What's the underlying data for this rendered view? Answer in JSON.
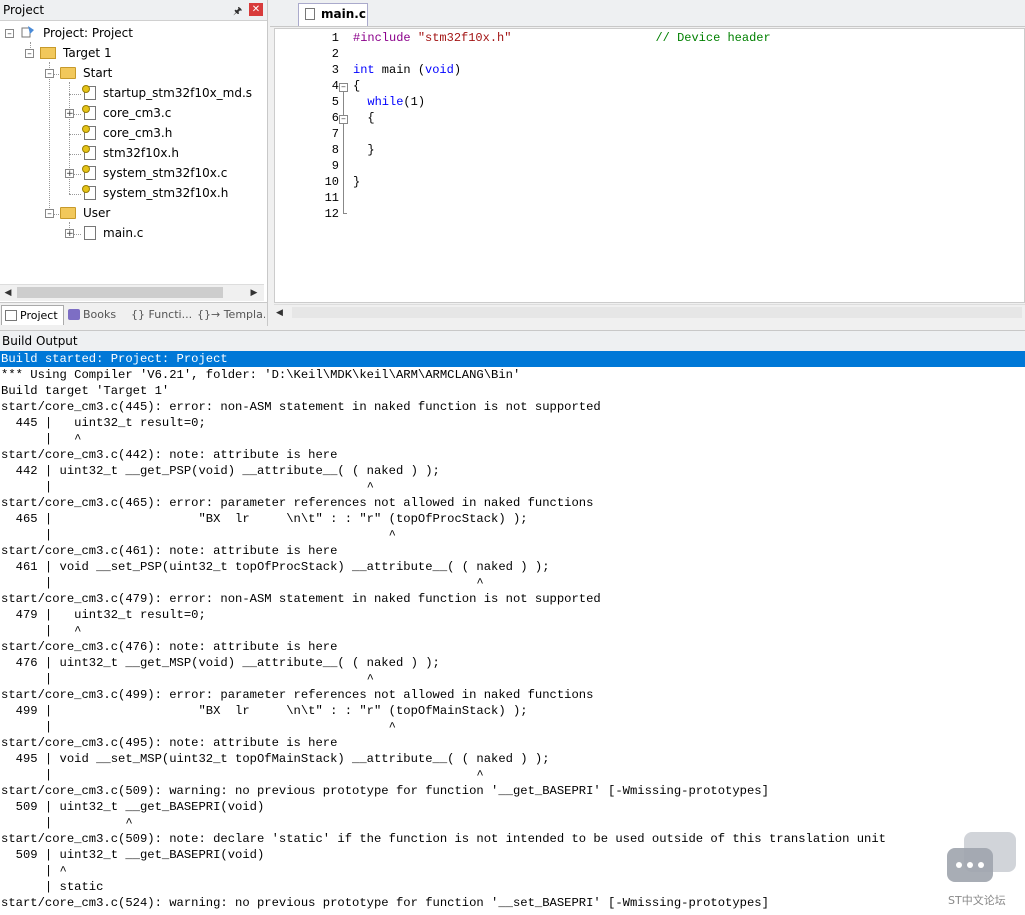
{
  "project_panel": {
    "title": "Project",
    "pin_icon": "pin-icon",
    "close_icon": "close-icon",
    "tree": {
      "root": "Project: Project",
      "target": "Target 1",
      "groups": [
        {
          "name": "Start",
          "files": [
            "startup_stm32f10x_md.s",
            "core_cm3.c",
            "core_cm3.h",
            "stm32f10x.h",
            "system_stm32f10x.c",
            "system_stm32f10x.h"
          ]
        },
        {
          "name": "User",
          "files": [
            "main.c"
          ]
        }
      ]
    },
    "tabs": [
      "Project",
      "Books",
      "{} Functi...",
      "{}→ Templa..."
    ]
  },
  "editor": {
    "tab": "main.c",
    "line_numbers": [
      "1",
      "2",
      "3",
      "4",
      "5",
      "6",
      "7",
      "8",
      "9",
      "10",
      "11",
      "12"
    ],
    "code": {
      "l1_directive": "#include",
      "l1_string": "\"stm32f10x.h\"",
      "l1_comment": "// Device header",
      "l3_type": "int",
      "l3_rest": " main (",
      "l3_void": "void",
      "l3_close": ")",
      "l4": "{",
      "l5_kw": "while",
      "l5_rest": "(1)",
      "l6": "{",
      "l8": "}",
      "l10": "}"
    }
  },
  "build_output": {
    "title": "Build Output",
    "lines": [
      "Build started: Project: Project",
      "*** Using Compiler 'V6.21', folder: 'D:\\Keil\\MDK\\keil\\ARM\\ARMCLANG\\Bin'",
      "Build target 'Target 1'",
      "start/core_cm3.c(445): error: non-ASM statement in naked function is not supported",
      "  445 |   uint32_t result=0;",
      "      |   ^",
      "start/core_cm3.c(442): note: attribute is here",
      "  442 | uint32_t __get_PSP(void) __attribute__( ( naked ) );",
      "      |                                           ^",
      "start/core_cm3.c(465): error: parameter references not allowed in naked functions",
      "  465 |                    \"BX  lr     \\n\\t\" : : \"r\" (topOfProcStack) );",
      "      |                                              ^",
      "start/core_cm3.c(461): note: attribute is here",
      "  461 | void __set_PSP(uint32_t topOfProcStack) __attribute__( ( naked ) );",
      "      |                                                          ^",
      "start/core_cm3.c(479): error: non-ASM statement in naked function is not supported",
      "  479 |   uint32_t result=0;",
      "      |   ^",
      "start/core_cm3.c(476): note: attribute is here",
      "  476 | uint32_t __get_MSP(void) __attribute__( ( naked ) );",
      "      |                                           ^",
      "start/core_cm3.c(499): error: parameter references not allowed in naked functions",
      "  499 |                    \"BX  lr     \\n\\t\" : : \"r\" (topOfMainStack) );",
      "      |                                              ^",
      "start/core_cm3.c(495): note: attribute is here",
      "  495 | void __set_MSP(uint32_t topOfMainStack) __attribute__( ( naked ) );",
      "      |                                                          ^",
      "start/core_cm3.c(509): warning: no previous prototype for function '__get_BASEPRI' [-Wmissing-prototypes]",
      "  509 | uint32_t __get_BASEPRI(void)",
      "      |          ^",
      "start/core_cm3.c(509): note: declare 'static' if the function is not intended to be used outside of this translation unit",
      "  509 | uint32_t __get_BASEPRI(void)",
      "      | ^",
      "      | static",
      "start/core_cm3.c(524): warning: no previous prototype for function '__set_BASEPRI' [-Wmissing-prototypes]"
    ]
  },
  "watermark": {
    "text": "ST中文论坛",
    "icon": "chat-bubbles-icon"
  },
  "colors": {
    "selection": "#0078d7",
    "keyword": "#0000ff",
    "string": "#a31515",
    "comment": "#008000"
  }
}
